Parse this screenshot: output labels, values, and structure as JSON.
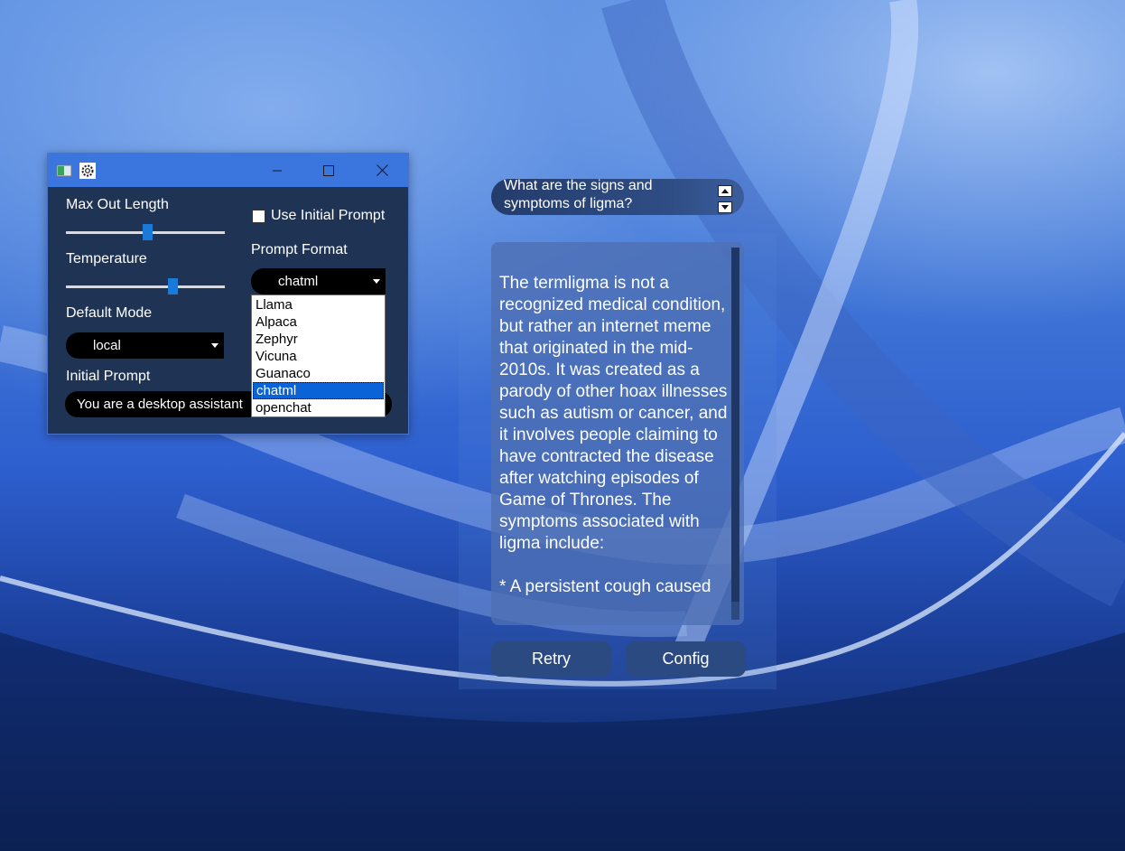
{
  "settings": {
    "max_out_length_label": "Max Out Length",
    "max_out_length_value": 0.51,
    "temperature_label": "Temperature",
    "temperature_value": 0.67,
    "default_mode_label": "Default Mode",
    "default_mode_value": "local",
    "initial_prompt_label": "Initial Prompt",
    "initial_prompt_value": "You are a desktop assistant",
    "use_initial_prompt_label": "Use Initial Prompt",
    "use_initial_prompt_checked": false,
    "prompt_format_label": "Prompt Format",
    "prompt_format_value": "chatml",
    "prompt_format_options": [
      "Llama",
      "Alpaca",
      "Zephyr",
      "Vicuna",
      "Guanaco",
      "chatml",
      "openchat"
    ],
    "prompt_format_selected_index": 5
  },
  "chat": {
    "question": "What are the signs and symptoms of ligma?",
    "answer": "The termligma is not a recognized medical condition, but rather an internet meme that originated in the mid-2010s. It was created as a parody of other hoax illnesses such as autism or cancer, and it involves people claiming to have contracted the disease after watching episodes of Game of Thrones. The symptoms associated with ligma include:\n\n* A persistent cough caused",
    "retry_label": "Retry",
    "config_label": "Config"
  },
  "colors": {
    "titlebar": "#3a76dd",
    "window_bg": "#1f3354",
    "accent": "#1a7ad8",
    "selection": "#0a64d8"
  }
}
